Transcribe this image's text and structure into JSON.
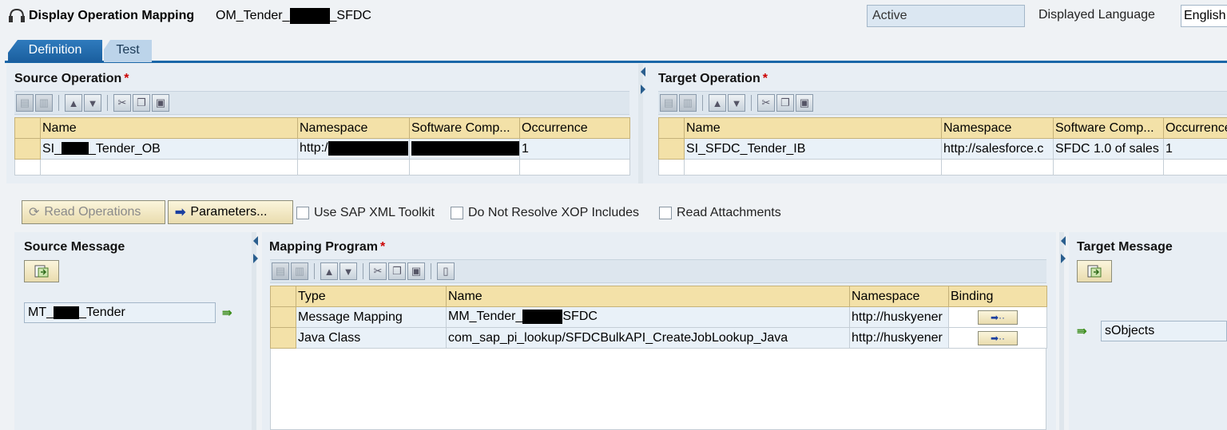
{
  "header": {
    "title": "Display Operation Mapping",
    "object_name_prefix": "OM_Tender_",
    "object_name_suffix": "_SFDC",
    "status": "Active",
    "language_label": "Displayed Language",
    "language_value": "English"
  },
  "tabs": [
    {
      "label": "Definition",
      "active": true
    },
    {
      "label": "Test",
      "active": false
    }
  ],
  "source_operation": {
    "title": "Source Operation",
    "columns": [
      "Name",
      "Namespace",
      "Software Comp...",
      "Occurrence"
    ],
    "row": {
      "name_prefix": "SI_",
      "name_suffix": "_Tender_OB",
      "namespace": "http:/",
      "software_component": "",
      "occurrence": "1"
    }
  },
  "target_operation": {
    "title": "Target Operation",
    "columns": [
      "Name",
      "Namespace",
      "Software Comp...",
      "Occurrence"
    ],
    "row": {
      "name": "SI_SFDC_Tender_IB",
      "namespace": "http://salesforce.c",
      "software_component": "SFDC 1.0 of sales",
      "occurrence": "1"
    }
  },
  "actions": {
    "read_operations": "Read Operations",
    "parameters": "Parameters...",
    "use_sap_xml_toolkit": "Use SAP XML Toolkit",
    "do_not_resolve_xop": "Do Not Resolve XOP Includes",
    "read_attachments": "Read Attachments"
  },
  "source_message": {
    "title": "Source Message",
    "value_prefix": "MT_",
    "value_suffix": "_Tender"
  },
  "mapping_program": {
    "title": "Mapping Program",
    "columns": [
      "Type",
      "Name",
      "Namespace",
      "Binding"
    ],
    "rows": [
      {
        "type": "Message Mapping",
        "name_prefix": "MM_Tender_",
        "name_suffix": "SFDC",
        "namespace": "http://huskyener"
      },
      {
        "type": "Java Class",
        "name": "com_sap_pi_lookup/SFDCBulkAPI_CreateJobLookup_Java",
        "namespace": "http://huskyener"
      }
    ]
  },
  "target_message": {
    "title": "Target Message",
    "value": "sObjects"
  },
  "colors": {
    "tab_active": "#1a67a8",
    "table_header": "#f3e1a8",
    "required": "#cc0000"
  }
}
